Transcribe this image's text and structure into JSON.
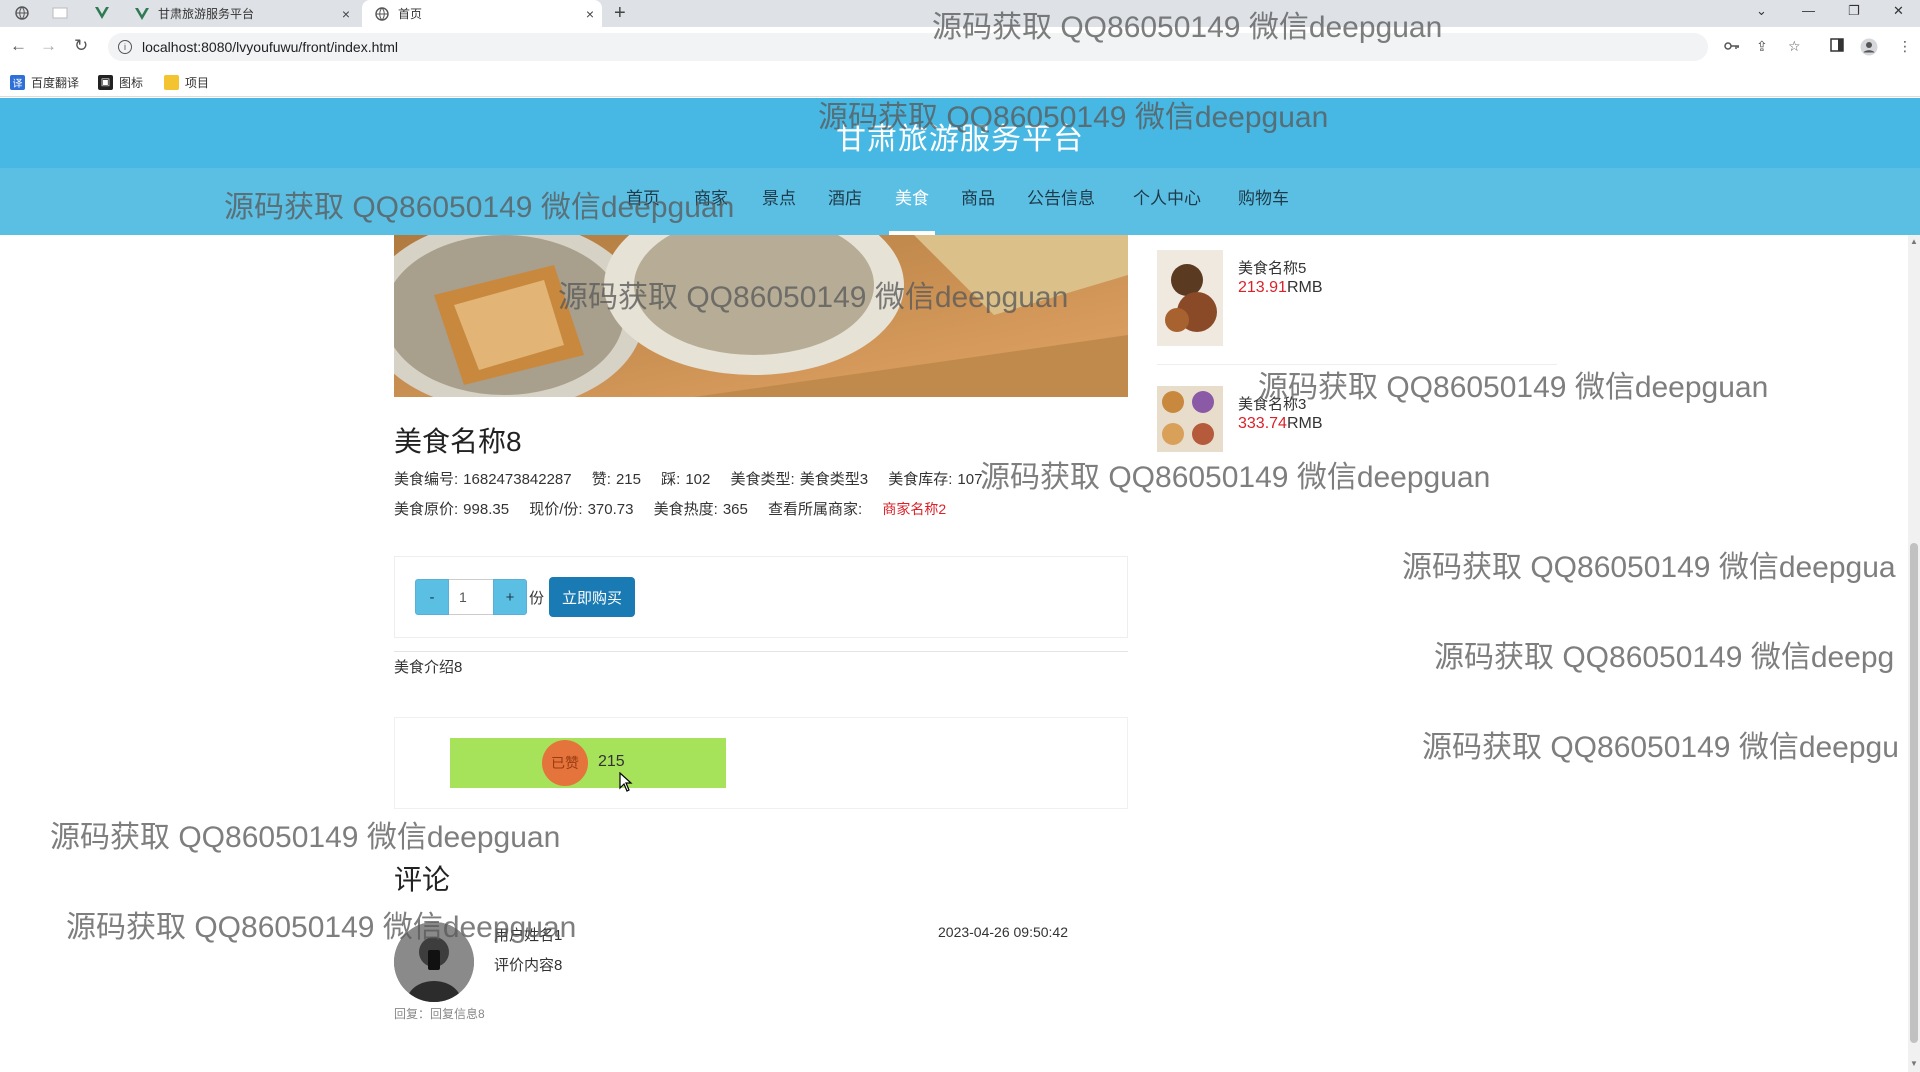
{
  "browser": {
    "tabs": [
      {
        "title": "甘肃旅游服务平台"
      },
      {
        "title": "首页"
      }
    ],
    "url": "localhost:8080/lvyoufuwu/front/index.html",
    "bookmarks": [
      "百度翻译",
      "图标",
      "项目"
    ],
    "new_tab_glyph": "+",
    "close_glyph": "×"
  },
  "site": {
    "title": "甘肃旅游服务平台",
    "nav": [
      "首页",
      "商家",
      "景点",
      "酒店",
      "美食",
      "商品",
      "公告信息",
      "个人中心",
      "购物车"
    ],
    "active_nav": "美食"
  },
  "food": {
    "name": "美食名称8",
    "line1": [
      {
        "label": "美食编号:",
        "value": "1682473842287"
      },
      {
        "label": "赞:",
        "value": "215"
      },
      {
        "label": "踩:",
        "value": "102"
      },
      {
        "label": "美食类型:",
        "value": "美食类型3"
      },
      {
        "label": "美食库存:",
        "value": "107"
      }
    ],
    "line2": [
      {
        "label": "美食原价:",
        "value": "998.35"
      },
      {
        "label": "现价/份:",
        "value": "370.73"
      },
      {
        "label": "美食热度:",
        "value": "365"
      },
      {
        "label": "查看所属商家:",
        "value": ""
      }
    ],
    "shop_link": "商家名称2",
    "quantity": "1",
    "minus_label": "-",
    "plus_label": "+",
    "unit_label": "份",
    "buy_label": "立即购买",
    "intro": "美食介绍8",
    "liked_label": "已赞",
    "like_count": "215"
  },
  "comments": {
    "title": "评论",
    "items": [
      {
        "user": "用户姓名1",
        "content": "评价内容8",
        "time": "2023-04-26 09:50:42",
        "reply": "回复：回复信息8"
      }
    ]
  },
  "recommend": [
    {
      "name": "美食名称5",
      "price": "213.91",
      "unit": "RMB"
    },
    {
      "name": "美食名称3",
      "price": "333.74",
      "unit": "RMB"
    }
  ],
  "watermark": "源码获取 QQ86050149 微信deepguan",
  "watermark_variants": [
    "源码获取 QQ86050149 微信deepgua",
    "源码获取 QQ86050149 微信deepg",
    "源码获取 QQ86050149 微信deepgu"
  ],
  "colors": {
    "header": "#47b8e3",
    "nav": "#5bbfe4",
    "buy_button": "#1a7ab3",
    "like_bar": "#a6e25a",
    "price": "#d9222a"
  }
}
